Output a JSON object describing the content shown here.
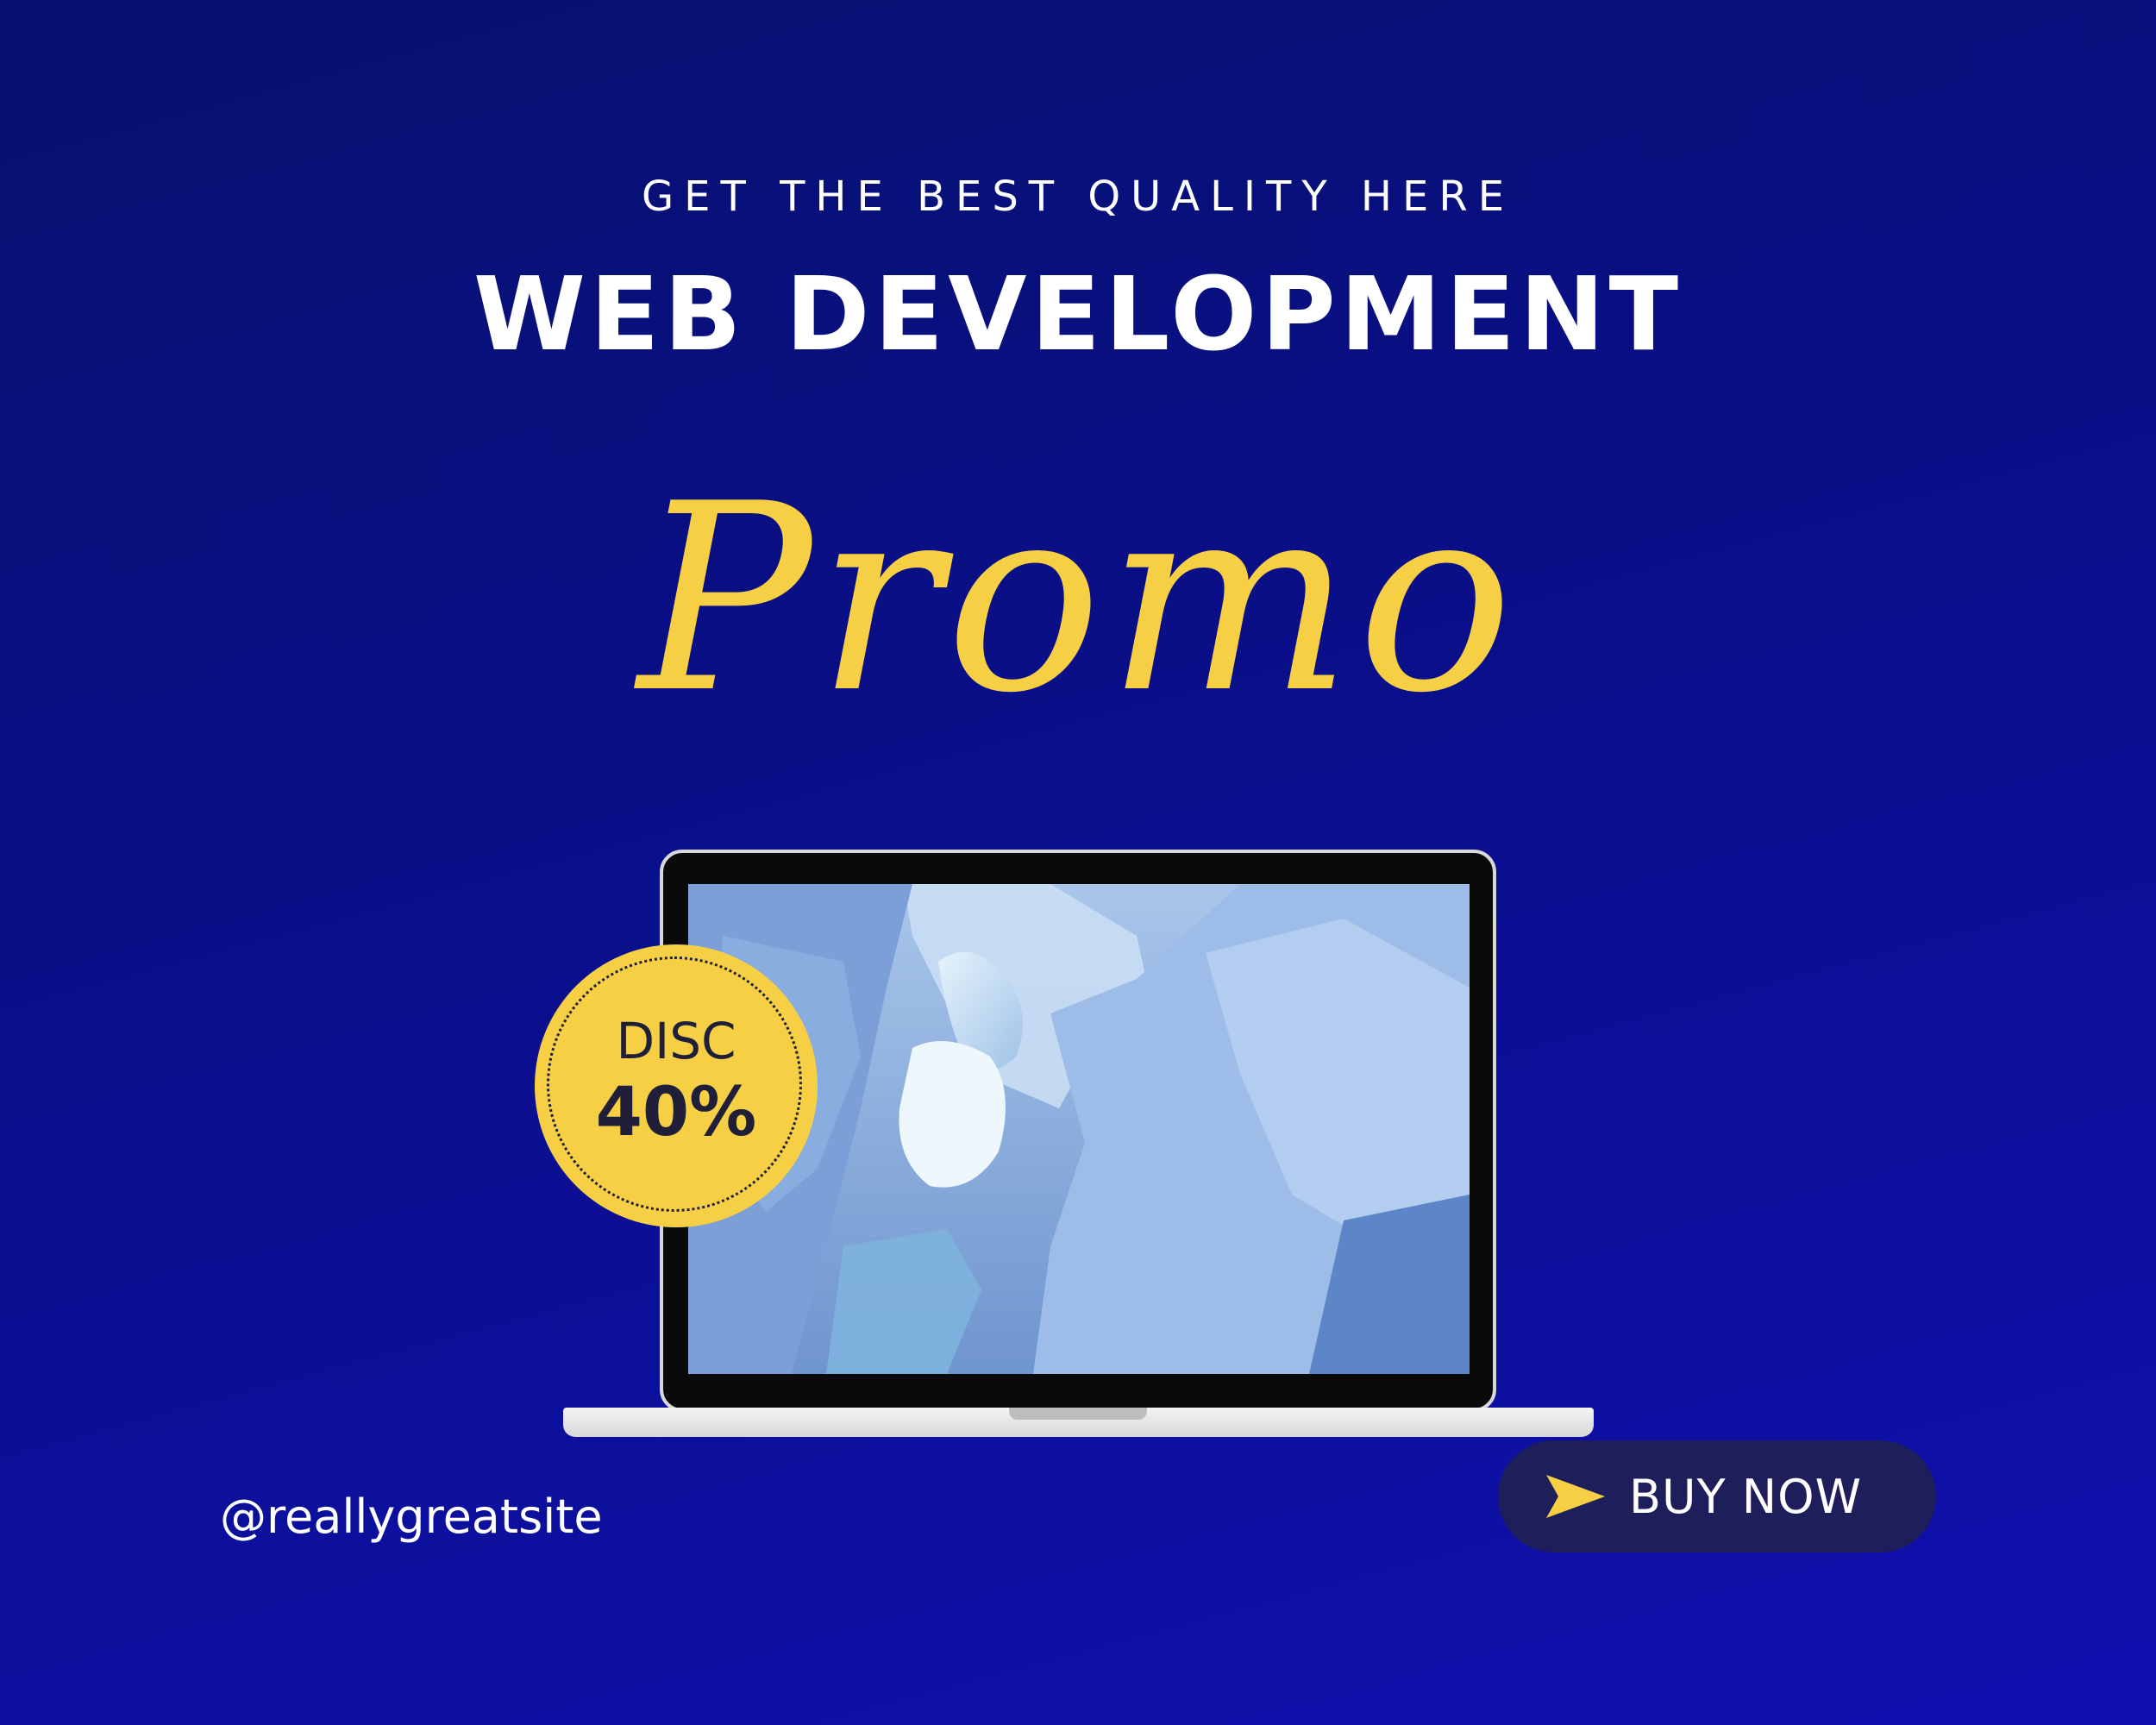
{
  "header": {
    "tagline": "GET THE BEST QUALITY HERE",
    "headline": "WEB DEVELOPMENT",
    "script_title": "Promo"
  },
  "badge": {
    "label": "DISC",
    "value": "40%"
  },
  "footer": {
    "handle": "@reallygreatsite",
    "buy_label": "BUY NOW",
    "buy_icon": "paper-plane-icon"
  },
  "colors": {
    "background": "#0a0f8a",
    "accent": "#f6cf44",
    "button": "#1d1e5a",
    "text": "#ffffff"
  }
}
